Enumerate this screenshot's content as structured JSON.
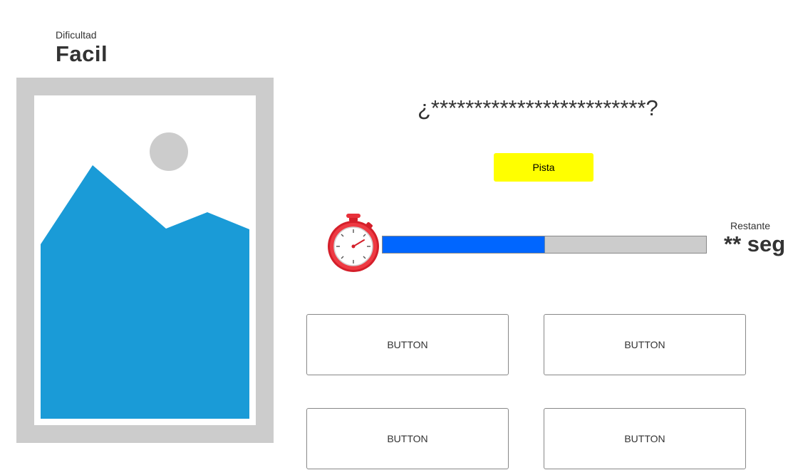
{
  "difficulty": {
    "caption": "Dificultad",
    "value": "Facil"
  },
  "image_placeholder": {
    "icon": "image-placeholder-icon",
    "frame_color": "#cccccc",
    "mountain_color": "#1a9bd7",
    "sun_color": "#cccccc"
  },
  "question": {
    "text": "¿*************************?"
  },
  "hint": {
    "label": "Pista",
    "color": "#ffff00"
  },
  "timer": {
    "icon": "stopwatch-icon",
    "progress": 0.5,
    "fill_color": "#0066ff",
    "track_color": "#cccccc",
    "remaining_caption": "Restante",
    "remaining_value": "** seg"
  },
  "answers": [
    {
      "label": "BUTTON"
    },
    {
      "label": "BUTTON"
    },
    {
      "label": "BUTTON"
    },
    {
      "label": "BUTTON"
    }
  ]
}
